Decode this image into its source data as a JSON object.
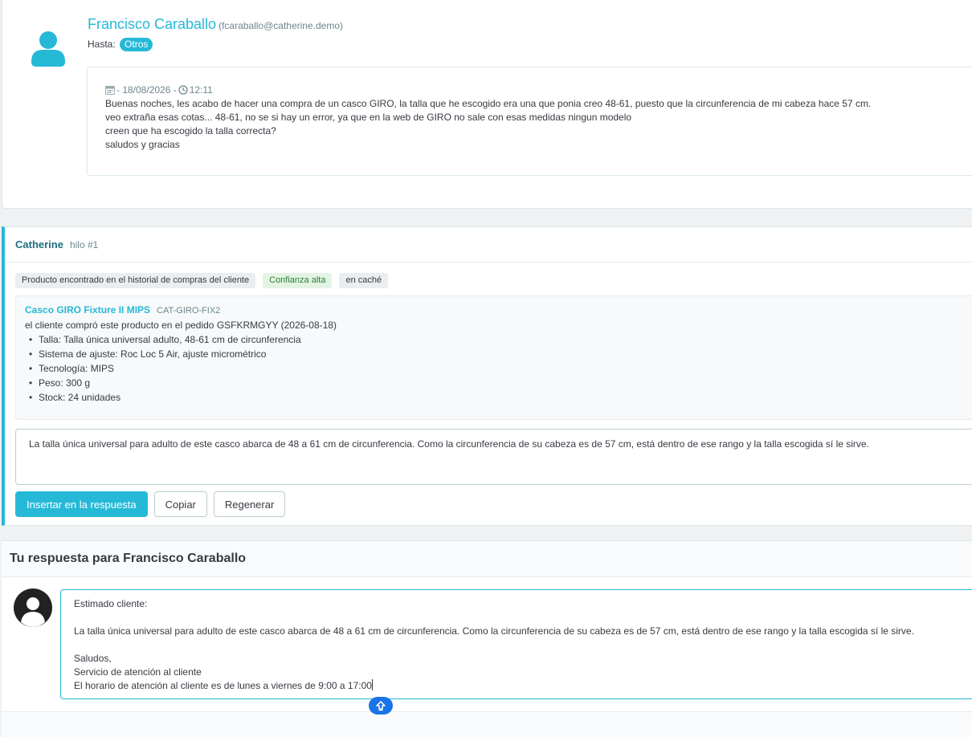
{
  "message": {
    "sender_name": "Francisco Caraballo",
    "sender_email": "(fcaraballo@catherine.demo)",
    "to_label": "Hasta:",
    "to_badge": "Otros",
    "date": "- 18/08/2026 -",
    "time": "12:11",
    "body_lines": [
      "Buenas noches, les acabo de hacer una compra de un casco GIRO, la talla que he escogido era una que ponia creo 48-61, puesto que la circunferencia de mi cabeza hace 57 cm.",
      "veo extraña esas cotas... 48-61, no se si hay un error, ya que en la web de GIRO no sale con esas medidas ningun modelo",
      "creen que ha escogido la talla correcta?",
      "saludos y gracias"
    ]
  },
  "assistant": {
    "name": "Catherine",
    "thread": "hilo #1",
    "tags": [
      "Producto encontrado en el historial de compras del cliente",
      "Confianza alta",
      "en caché"
    ],
    "product": {
      "name": "Casco GIRO Fixture II MIPS",
      "ref": "CAT-GIRO-FIX2",
      "note": "el cliente compró este producto en el pedido GSFKRMGYY (2026-08-18)",
      "specs": [
        "Talla: Talla única universal adulto, 48-61 cm de circunferencia",
        "Sistema de ajuste: Roc Loc 5 Air, ajuste micrométrico",
        "Tecnología: MIPS",
        "Peso: 300 g",
        "Stock: 24 unidades"
      ]
    },
    "suggested_answer": "La talla única universal para adulto de este casco abarca de 48 a 61 cm de circunferencia. Como la circunferencia de su cabeza es de 57 cm, está dentro de ese rango y la talla escogida sí le sirve.",
    "buttons": {
      "insert": "Insertar en la respuesta",
      "copy": "Copiar",
      "regenerate": "Regenerar"
    }
  },
  "reply": {
    "title_prefix": "Tu respuesta para",
    "title_name": "Francisco Caraballo",
    "lines": [
      "Estimado cliente:",
      "",
      "La talla única universal para adulto de este casco abarca de 48 a 61 cm de circunferencia. Como la circunferencia de su cabeza es de 57 cm, está dentro de ese rango y la talla escogida sí le sirve.",
      "",
      "Saludos,",
      "Servicio de atención al cliente",
      "El horario de atención al cliente es de lunes a viernes de 9:00 a 17:00"
    ]
  },
  "colors": {
    "accent": "#25b9d7",
    "assistant_title": "#1f6c7e",
    "confidence_tag_bg": "#e3f4e5",
    "resize_handle": "#1a73e8"
  }
}
